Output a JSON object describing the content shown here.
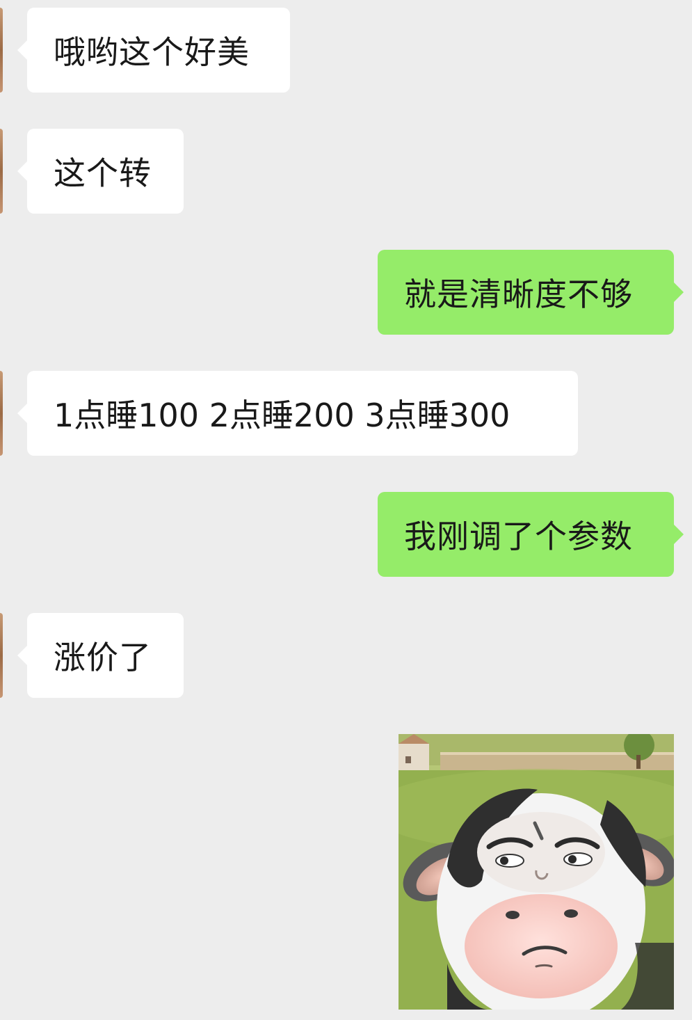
{
  "messages": [
    {
      "side": "in",
      "text": "哦哟这个好美"
    },
    {
      "side": "in",
      "text": "这个转"
    },
    {
      "side": "out",
      "text": "就是清晰度不够"
    },
    {
      "side": "in",
      "text": "1点睡100 2点睡200 3点睡300"
    },
    {
      "side": "out",
      "text": "我刚调了个参数"
    },
    {
      "side": "in",
      "text": "涨价了"
    }
  ],
  "sticker": {
    "name": "cow-face-sticker"
  },
  "colors": {
    "background": "#ededed",
    "incoming_bubble": "#ffffff",
    "outgoing_bubble": "#95ec69",
    "text": "#191919"
  }
}
